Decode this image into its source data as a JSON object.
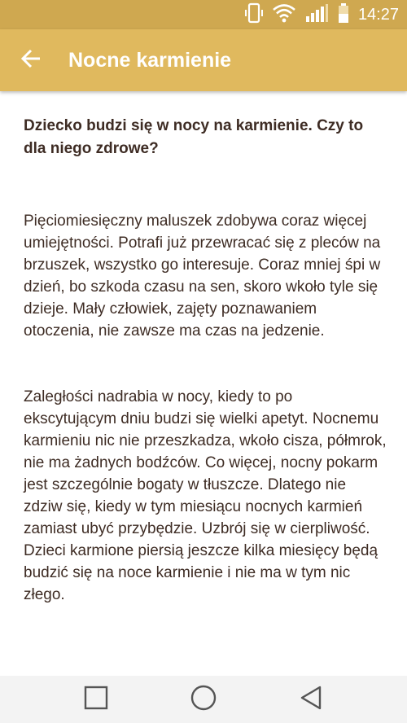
{
  "status_bar": {
    "time": "14:27",
    "icons": [
      "phone-vibrate-icon",
      "wifi-icon",
      "signal-icon",
      "battery-icon"
    ]
  },
  "app_bar": {
    "title": "Nocne karmienie",
    "back_icon": "arrow-back-icon",
    "background_color": "#e0b95e"
  },
  "article": {
    "heading": "Dziecko budzi się w nocy na karmienie. Czy to dla niego zdrowe?",
    "paragraphs": [
      "Pięciomiesięczny maluszek zdobywa coraz więcej umiejętności. Potrafi już przewracać się z pleców na brzuszek, wszystko go interesuje. Coraz mniej śpi w dzień, bo szkoda czasu na sen, skoro wkoło tyle się dzieje. Mały człowiek, zajęty poznawaniem otoczenia, nie zawsze ma czas na jedzenie.",
      "Zaległości nadrabia w nocy, kiedy to po ekscytującym dniu budzi się wielki apetyt. Nocnemu karmieniu nic nie przeszkadza, wkoło cisza, półmrok, nie ma żadnych bodźców. Co więcej, nocny pokarm jest szczególnie bogaty w tłuszcze. Dlatego nie zdziw się, kiedy w tym miesiącu nocnych karmień zamiast ubyć przybędzie. Uzbrój się w cierpliwość. Dzieci karmione piersią jeszcze kilka miesięcy będą budzić się na noce karmienie i nie ma w tym nic złego."
    ],
    "text_color": "#3e2c24"
  },
  "nav_bar": {
    "buttons": [
      "recent-apps-icon",
      "home-icon",
      "back-triangle-icon"
    ]
  }
}
